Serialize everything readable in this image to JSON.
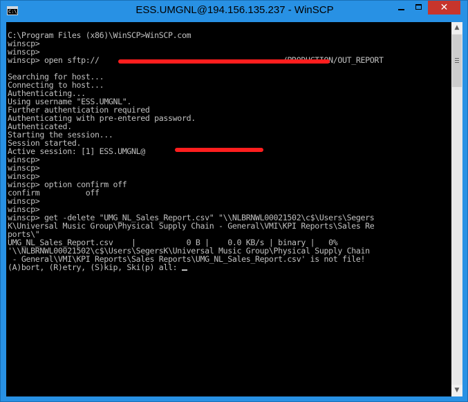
{
  "window": {
    "title": "ESS.UMGNL@194.156.135.237 - WinSCP",
    "minimize_label": "",
    "maximize_label": "",
    "close_label": "✕",
    "app_icon_text": "C:\\"
  },
  "scrollbar": {
    "up_arrow": "▲",
    "down_arrow": "▼"
  },
  "console": {
    "lines": [
      "C:\\Program Files (x86)\\WinSCP>WinSCP.com",
      "winscp>",
      "winscp>",
      "winscp> open sftp://                                        /PRODUCTION/OUT_REPORT",
      "",
      "Searching for host...",
      "Connecting to host...",
      "Authenticating...",
      "Using username \"ESS.UMGNL\".",
      "Further authentication required",
      "Authenticating with pre-entered password.",
      "Authenticated.",
      "Starting the session...",
      "Session started.",
      "Active session: [1] ESS.UMGNL@",
      "winscp>",
      "winscp>",
      "winscp>",
      "winscp> option confirm off",
      "confirm          off",
      "winscp>",
      "winscp>",
      "winscp> get -delete \"UMG_NL_Sales_Report.csv\" \"\\\\NLBRNWL00021502\\c$\\Users\\Segers",
      "K\\Universal Music Group\\Physical Supply Chain - General\\VMI\\KPI Reports\\Sales Re",
      "ports\\\"",
      "UMG_NL_Sales_Report.csv    |           0 B |    0.0 KB/s | binary |   0%",
      "'\\\\NLBRNWL00021502\\c$\\Users\\SegersK\\Universal Music Group\\Physical Supply Chain",
      " - General\\VMI\\KPI Reports\\Sales Reports\\UMG_NL_Sales_Report.csv' is not file!",
      "(A)bort, (R)etry, (S)kip, Ski(p) all: "
    ]
  }
}
